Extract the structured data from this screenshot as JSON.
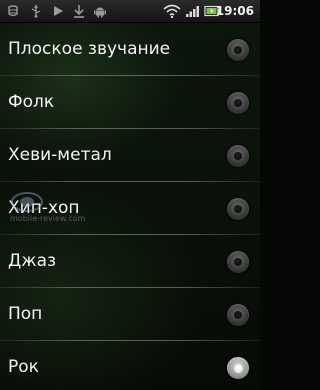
{
  "status_bar": {
    "time": "19:06",
    "icons": [
      "usb-debug-icon",
      "usb-icon",
      "play-icon",
      "download-icon",
      "android-icon",
      "wifi-icon",
      "signal-icon",
      "battery-icon"
    ]
  },
  "equalizer_presets": {
    "items": [
      {
        "label": "Плоское звучание",
        "checked": false
      },
      {
        "label": "Фолк",
        "checked": false
      },
      {
        "label": "Хеви-метал",
        "checked": false
      },
      {
        "label": "Хип-хоп",
        "checked": false
      },
      {
        "label": "Джаз",
        "checked": false
      },
      {
        "label": "Поп",
        "checked": false
      },
      {
        "label": "Рок",
        "checked": true
      }
    ]
  },
  "watermark": {
    "text": "mobile-review.com"
  },
  "colors": {
    "text": "#f4f4f4",
    "background": "#0a1209",
    "status_bar": "#1c1c1c"
  }
}
